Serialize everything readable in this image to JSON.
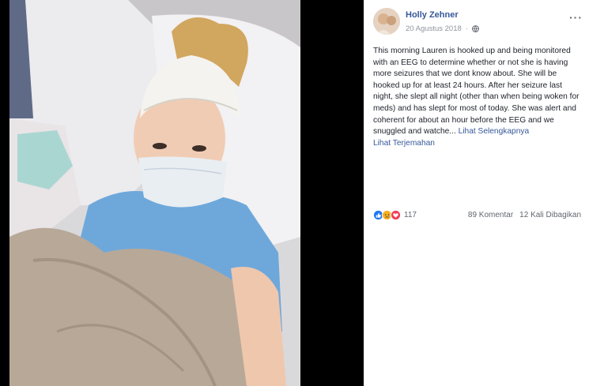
{
  "post": {
    "author": "Holly Zehner",
    "date": "20 Agustus 2018",
    "separator": "·",
    "more_label": "···",
    "text": "This morning Lauren is hooked up and being monitored with an EEG to determine whether or not she is having more seizures that we dont know about. She will be hooked up for at least 24 hours. After her seizure last night, she slept all night (other than when being woken for meds) and has slept for most of today. She was alert and coherent for about an hour before the EEG and we snuggled and watche...",
    "see_more": "Lihat Selengkapnya",
    "see_translation": "Lihat Terjemahan"
  },
  "stats": {
    "reactions_count": "117",
    "comments": "89 Komentar",
    "shares": "12 Kali Dibagikan",
    "reaction_icons": [
      "like-icon",
      "sad-icon",
      "love-icon"
    ]
  },
  "colors": {
    "link": "#365899",
    "meta": "#90949c",
    "text": "#1d2129",
    "like": "#2078f4",
    "love": "#f33e58",
    "sad": "#f7b125"
  }
}
